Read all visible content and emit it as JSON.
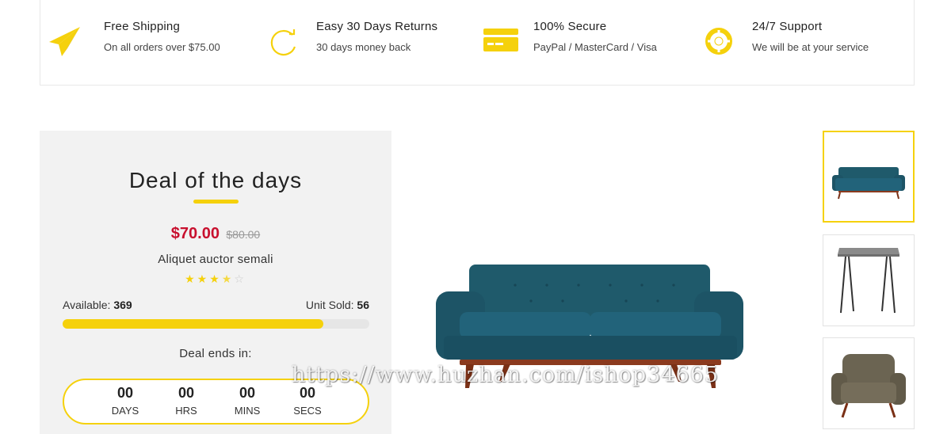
{
  "features": [
    {
      "icon": "paper-plane-icon",
      "title": "Free Shipping",
      "subtitle": "On all orders over $75.00"
    },
    {
      "icon": "refresh-icon",
      "title": "Easy 30 Days Returns",
      "subtitle": "30 days money back"
    },
    {
      "icon": "credit-card-icon",
      "title": "100% Secure",
      "subtitle": "PayPal / MasterCard / Visa"
    },
    {
      "icon": "lifebuoy-icon",
      "title": "24/7 Support",
      "subtitle": "We will be at your service"
    }
  ],
  "deal": {
    "title": "Deal of the days",
    "price": "$70.00",
    "old_price": "$80.00",
    "product_name": "Aliquet auctor semali",
    "rating": {
      "value": 3.5,
      "max": 5,
      "stars": [
        "★",
        "★",
        "★",
        "★",
        "☆"
      ]
    },
    "available_label": "Available:",
    "available_value": "369",
    "sold_label": "Unit Sold:",
    "sold_value": "56",
    "progress_fraction": 0.85,
    "ends_label": "Deal ends in:",
    "countdown": [
      {
        "value": "00",
        "label": "DAYS"
      },
      {
        "value": "00",
        "label": "HRS"
      },
      {
        "value": "00",
        "label": "MINS"
      },
      {
        "value": "00",
        "label": "SECS"
      }
    ]
  },
  "gallery": {
    "main_image": "teal-sofa",
    "thumbnails": [
      "teal-sofa",
      "side-table",
      "armchair"
    ],
    "active_index": 0
  },
  "watermark": "https://www.huzhan.com/ishop34665",
  "colors": {
    "accent": "#f5d10c",
    "price": "#c8102e",
    "sofa": "#1f5a6b",
    "wood": "#8b3a1e"
  }
}
